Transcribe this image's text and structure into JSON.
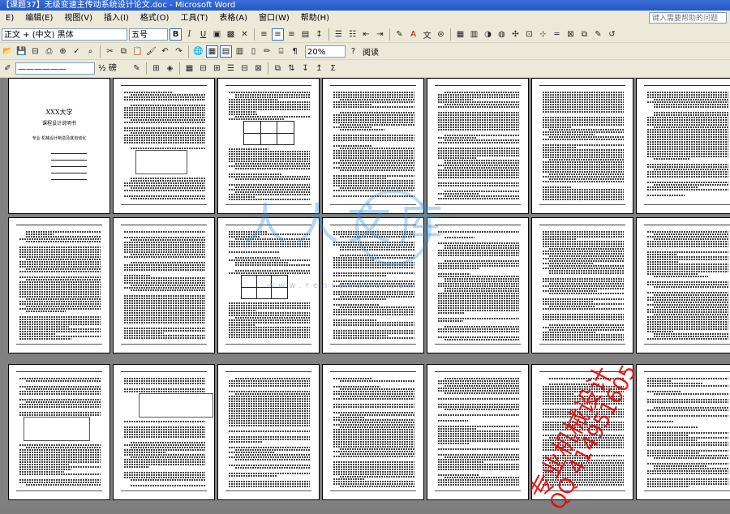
{
  "window": {
    "title": "【课题37】无级变速主传动系统设计论文.doc - Microsoft Word"
  },
  "menu": {
    "items": [
      "E)",
      "编辑(E)",
      "视图(V)",
      "插入(I)",
      "格式(O)",
      "工具(T)",
      "表格(A)",
      "窗口(W)",
      "帮助(H)"
    ],
    "help_placeholder": "键入需要帮助的问题"
  },
  "formatting": {
    "style": "正文 + (中文) 黑体",
    "font_size": "五号",
    "bold": "B",
    "italic": "I",
    "underline": "U"
  },
  "standard": {
    "zoom": "20%",
    "read_label": "阅读"
  },
  "drawing": {
    "line_width_label": "½ 磅"
  },
  "pages": {
    "cover_title": "XXX大学",
    "cover_subtitle": "课程设计说明书",
    "cover_line": "专业 机械设计制造及其自动化"
  },
  "watermark": {
    "text": "人人文库",
    "url": "www.renrendoc.com"
  },
  "stamp": {
    "line1": "专业机械设计",
    "line2": "QQ 414951605"
  }
}
